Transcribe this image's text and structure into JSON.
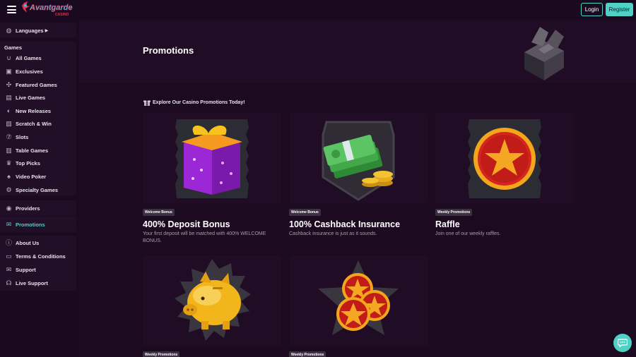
{
  "header": {
    "logo_text": "Avantgarde",
    "logo_sub": "CASINO",
    "login_label": "Login",
    "register_label": "Register"
  },
  "sidebar": {
    "languages": "Languages",
    "games_heading": "Games",
    "games": [
      {
        "label": "All Games",
        "icon": "horseshoe-icon"
      },
      {
        "label": "Exclusives",
        "icon": "exclusive-icon"
      },
      {
        "label": "Featured Games",
        "icon": "puzzle-icon"
      },
      {
        "label": "Live Games",
        "icon": "cards-icon"
      },
      {
        "label": "New Releases",
        "icon": "new-icon"
      },
      {
        "label": "Scratch & Win",
        "icon": "scratch-icon"
      },
      {
        "label": "Slots",
        "icon": "slots-icon"
      },
      {
        "label": "Table Games",
        "icon": "table-icon"
      },
      {
        "label": "Top Picks",
        "icon": "trophy-icon"
      },
      {
        "label": "Video Poker",
        "icon": "poker-icon"
      },
      {
        "label": "Specialty Games",
        "icon": "gear-icon"
      }
    ],
    "providers": "Providers",
    "promotions": "Promotions",
    "info": [
      {
        "label": "About Us",
        "icon": "info-icon"
      },
      {
        "label": "Terms & Conditions",
        "icon": "document-icon"
      },
      {
        "label": "Support",
        "icon": "mail-icon"
      },
      {
        "label": "Live Support",
        "icon": "headset-icon"
      }
    ]
  },
  "hero": {
    "title": "Promotions"
  },
  "content": {
    "explore_text": "Explore Our Casino Promotions Today!",
    "cards": [
      {
        "badge": "Welcome Bonus",
        "title": "400% Deposit Bonus",
        "desc": "Your first deposit will be matched with 400% WELCOME BONUS."
      },
      {
        "badge": "Welcome Bonus",
        "title": "100% Cashback Insurance",
        "desc": "Cashback insurance is just as it sounds."
      },
      {
        "badge": "Weekly Promotions",
        "title": "Raffle",
        "desc": "Join one of our weekly raffles."
      },
      {
        "badge": "Weekly Promotions",
        "title": "",
        "desc": ""
      },
      {
        "badge": "Weekly Promotions",
        "title": "",
        "desc": ""
      }
    ]
  },
  "colors": {
    "accent": "#4fd1c5",
    "background": "#1c0b20",
    "sidebar": "#1a0a1f"
  }
}
